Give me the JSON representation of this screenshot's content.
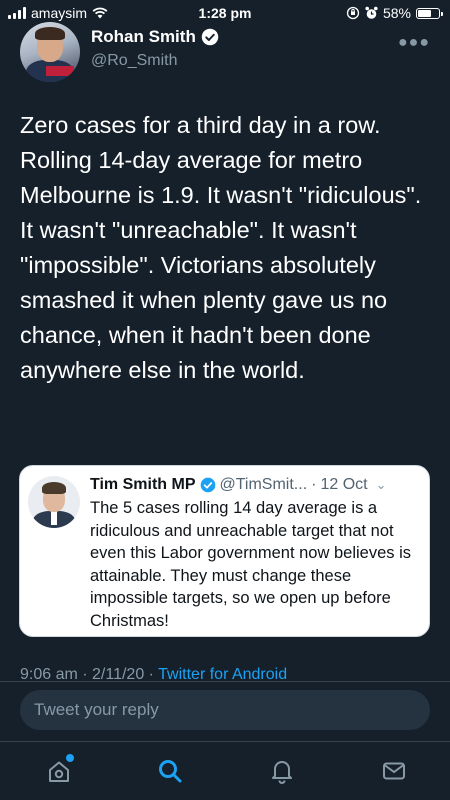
{
  "status_bar": {
    "carrier": "amaysim",
    "time": "1:28 pm",
    "battery": "58%",
    "battery_level": 0.58
  },
  "tweet": {
    "author_name": "Rohan Smith",
    "author_handle": "@Ro_Smith",
    "text": "Zero cases for a third day in a row.\nRolling 14-day average for metro Melbourne is 1.9. It wasn't \"ridiculous\". It wasn't \"unreachable\". It wasn't \"impossible\". Victorians absolutely smashed it when plenty gave us no chance, when it hadn't been done anywhere else in the world.",
    "timestamp": "9:06 am · 2/11/20 ·",
    "source": "Twitter for Android"
  },
  "quoted_tweet": {
    "author_name": "Tim Smith MP",
    "author_handle": "@TimSmit...",
    "date": "12 Oct",
    "text": "The 5 cases rolling 14 day average is a ridiculous and unreachable target that not even this Labor government now believes is attainable. They must change these impossible targets, so we open up before Christmas!"
  },
  "reply": {
    "placeholder": "Tweet your reply"
  },
  "nav": {
    "items": [
      "home-icon",
      "search-icon",
      "notifications-icon",
      "messages-icon"
    ]
  },
  "colors": {
    "background": "#15202b",
    "accent": "#1da1f2",
    "secondary_text": "#8899a6"
  }
}
